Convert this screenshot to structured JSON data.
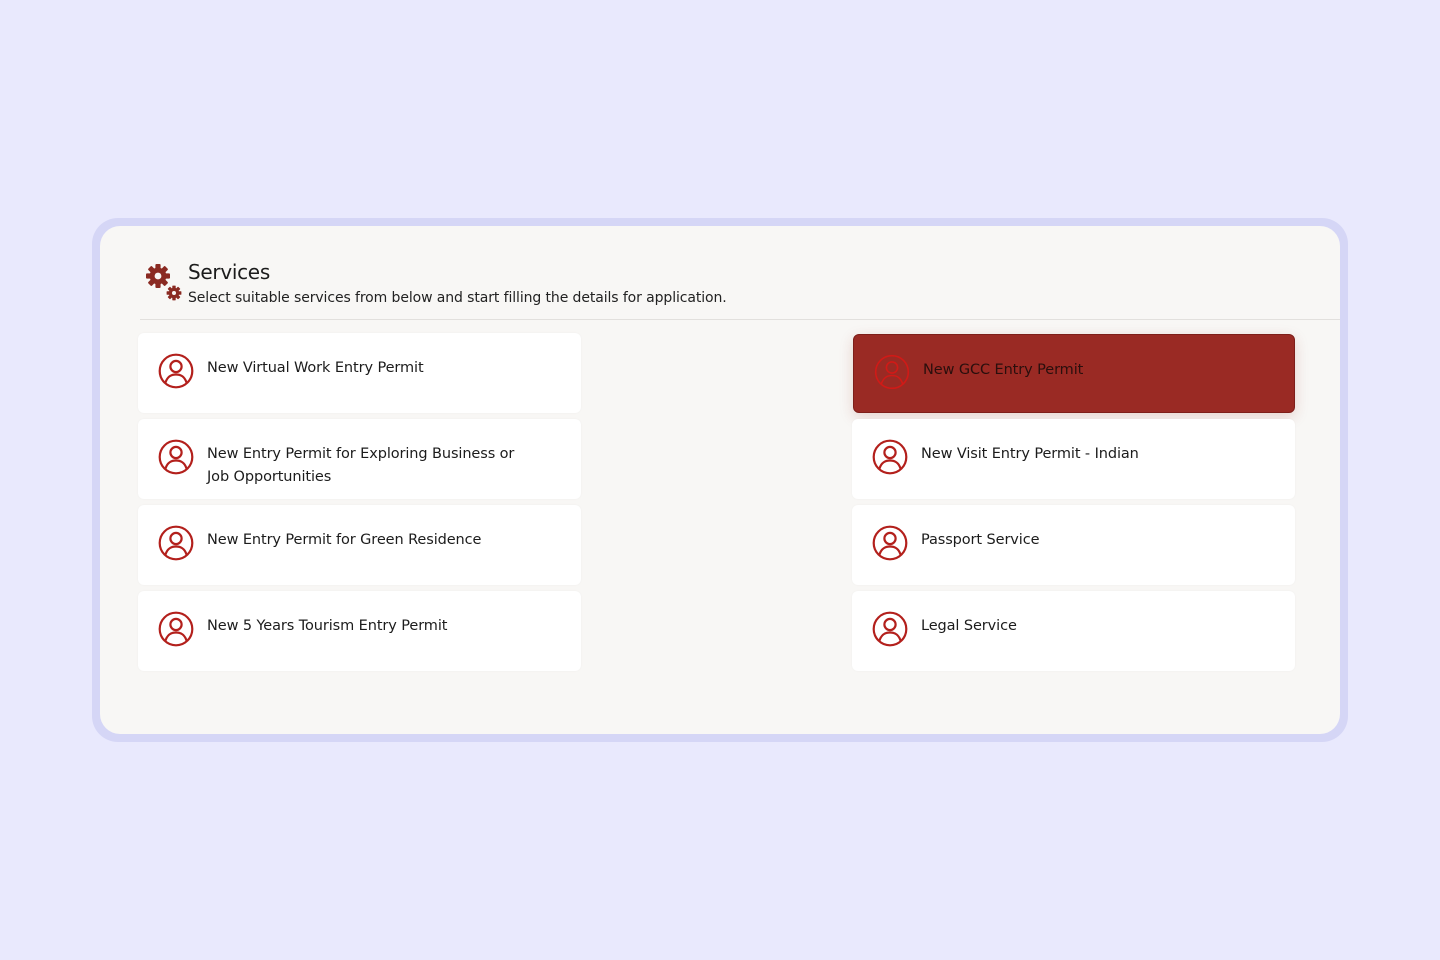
{
  "header": {
    "title": "Services",
    "subtitle": "Select suitable services from below and start filling the details for application.",
    "icon": "gears-icon"
  },
  "colors": {
    "background": "#e9e9fd",
    "accent": "#9a2a24",
    "icon_stroke": "#b3201c",
    "panel": "#f8f7f5"
  },
  "services": {
    "left": [
      {
        "label": "New Virtual Work Entry Permit",
        "icon": "user-circle-icon"
      },
      {
        "label": "New Entry Permit for Exploring Business or Job Opportunities",
        "icon": "user-circle-icon"
      },
      {
        "label": "New Entry Permit for Green Residence",
        "icon": "user-circle-icon"
      },
      {
        "label": "New 5 Years Tourism Entry Permit",
        "icon": "user-circle-icon"
      }
    ],
    "right": [
      {
        "label": "New GCC Entry Permit",
        "icon": "user-circle-icon",
        "selected": true
      },
      {
        "label": "New Visit Entry Permit - Indian",
        "icon": "user-circle-icon"
      },
      {
        "label": "Passport Service",
        "icon": "user-circle-icon"
      },
      {
        "label": "Legal Service",
        "icon": "user-circle-icon"
      }
    ]
  }
}
